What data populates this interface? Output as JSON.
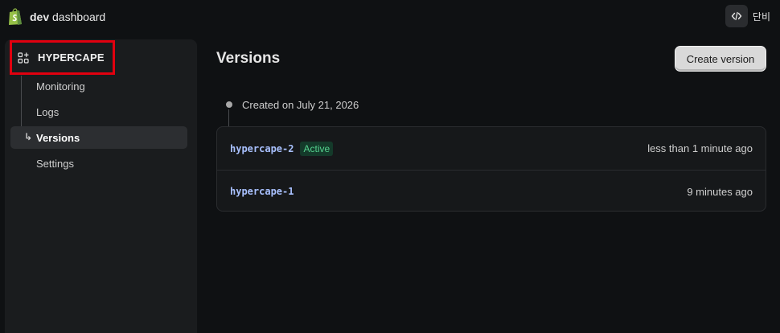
{
  "header": {
    "brand_bold": "dev",
    "brand_rest": " dashboard",
    "user": "단비"
  },
  "sidebar": {
    "app_name": "HYPERCAPE",
    "items": [
      {
        "label": "Monitoring"
      },
      {
        "label": "Logs"
      },
      {
        "label": "Versions",
        "active": true
      },
      {
        "label": "Settings"
      }
    ]
  },
  "main": {
    "title": "Versions",
    "create_button": "Create version",
    "timeline_label": "Created on July 21, 2026",
    "versions": [
      {
        "name": "hypercape-2",
        "badge": "Active",
        "time": "less than 1 minute ago"
      },
      {
        "name": "hypercape-1",
        "badge": "",
        "time": "9 minutes ago"
      }
    ]
  },
  "colors": {
    "background": "#0f1113",
    "sidebar": "#1a1c1e",
    "highlight_box": "#e1000f",
    "active_badge_text": "#55d38f",
    "version_name": "#a9c1ff",
    "shopify_green": "#95bf47"
  },
  "icons": [
    "shopify-bag-icon",
    "code-icon",
    "app-grid-icon",
    "arrow-right-icon"
  ]
}
